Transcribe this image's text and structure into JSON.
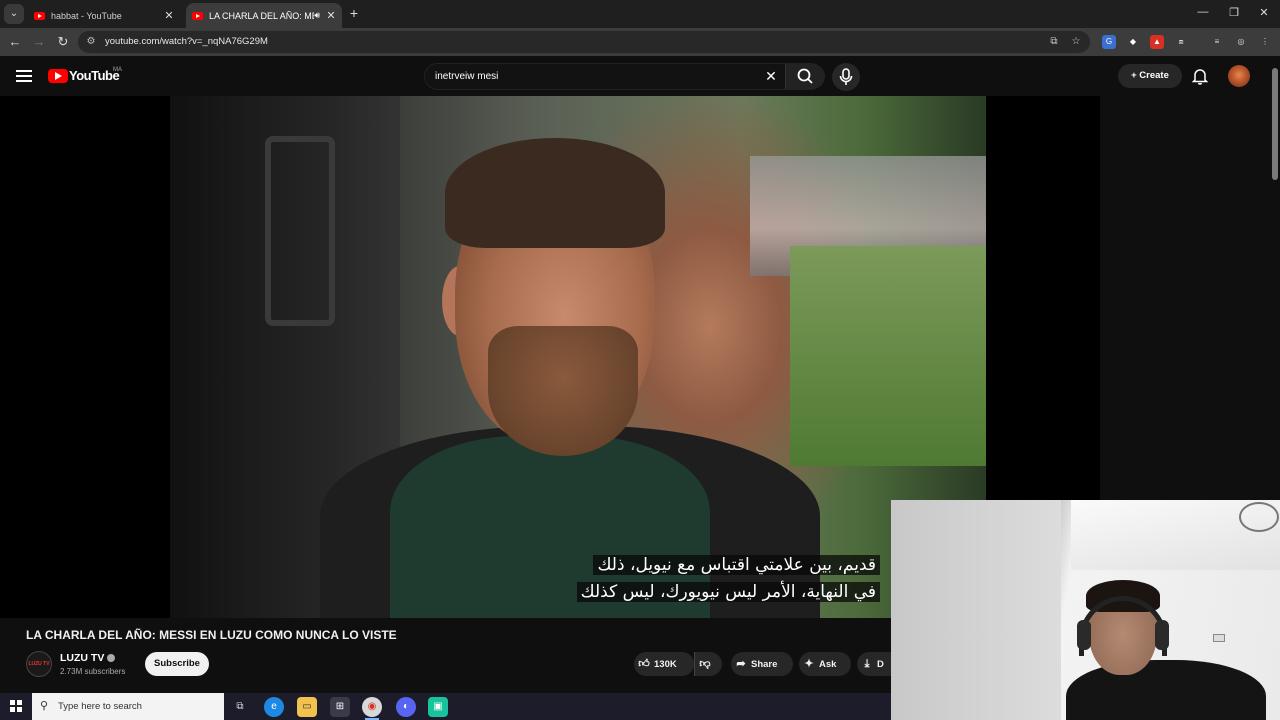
{
  "browser": {
    "tabs": [
      {
        "label": "habbat - YouTube",
        "active": false
      },
      {
        "label": "LA CHARLA DEL AÑO: MES",
        "active": true,
        "audio": true
      }
    ],
    "url": "youtube.com/watch?v=_nqNA76G29M"
  },
  "youtube": {
    "logo_text": "YouTube",
    "country_code": "MA",
    "search_query": "inetrveiw mesi",
    "create_label": "Create"
  },
  "video": {
    "subtitle_lines": [
      "قديم، بين علامتي اقتباس مع نيويل، ذلك",
      "في النهاية، الأمر ليس نيويورك، ليس كذلك"
    ],
    "title": "LA CHARLA DEL AÑO: MESSI EN LUZU COMO NUNCA LO VISTE",
    "channel_name": "LUZU TV",
    "channel_avatar_text": "LUZU TV",
    "subscribers": "2.73M subscribers",
    "subscribe_label": "Subscribe",
    "like_count": "130K",
    "share_label": "Share",
    "ask_label": "Ask",
    "download_label": "D"
  },
  "taskbar": {
    "search_placeholder": "Type here to search"
  },
  "colors": {
    "youtube_red": "#ff0000",
    "page_bg": "#0f0f0f",
    "pill_bg": "#272727"
  }
}
